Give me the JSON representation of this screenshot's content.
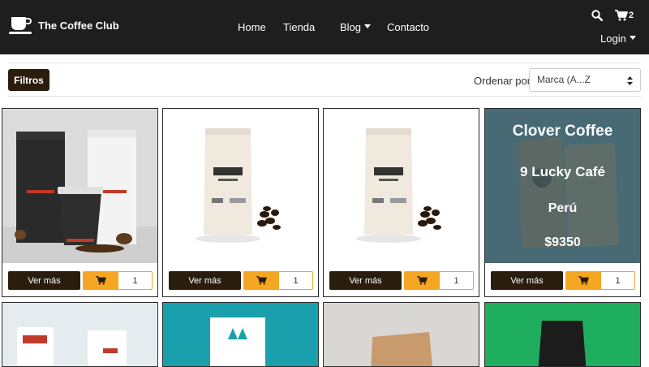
{
  "brand": {
    "name": "The Coffee Club"
  },
  "nav": {
    "home": "Home",
    "store": "Tienda",
    "blog": "Blog",
    "contact": "Contacto",
    "login": "Login",
    "cart_count": "2"
  },
  "toolbar": {
    "filters": "Filtros",
    "sort_label": "Ordenar por",
    "sort_value": "Marca (A...Z"
  },
  "products": [
    {
      "more": "Ver más",
      "qty": "1"
    },
    {
      "more": "Ver más",
      "qty": "1"
    },
    {
      "more": "Ver más",
      "qty": "1"
    },
    {
      "more": "Ver más",
      "qty": "1",
      "overlay": {
        "name": "Clover Coffee",
        "brand": "9 Lucky Café",
        "origin": "Perú",
        "price": "$9350"
      }
    }
  ],
  "colors": {
    "navbar": "#1e1e1e",
    "dark_brown": "#2b1d0e",
    "accent_orange": "#f5a623"
  }
}
